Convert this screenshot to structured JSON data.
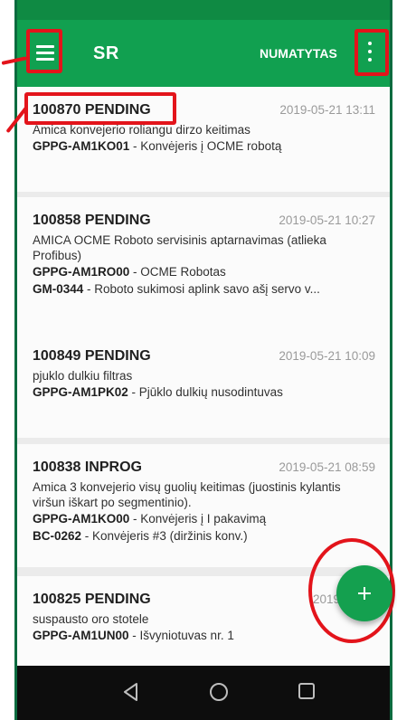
{
  "app": {
    "title": "SR",
    "action_label": "NUMATYTAS",
    "menu_icon": "menu-icon",
    "overflow_icon": "more-vert-icon"
  },
  "requests": [
    {
      "id_status": "100870 PENDING",
      "date": "2019-05-21 13:11",
      "description": "Amica konvejerio roliangu dirzo keitimas",
      "lines": [
        {
          "code": "GPPG-AM1KO01",
          "text": " - Konvėjeris į OCME robotą"
        }
      ]
    },
    {
      "id_status": "100858 PENDING",
      "date": "2019-05-21 10:27",
      "description": "AMICA OCME Roboto servisinis aptarnavimas (atlieka Profibus)",
      "lines": [
        {
          "code": "GPPG-AM1RO00",
          "text": " - OCME Robotas"
        },
        {
          "code": "GM-0344",
          "text": " - Roboto sukimosi aplink savo ašį servo v..."
        }
      ]
    },
    {
      "id_status": "100849 PENDING",
      "date": "2019-05-21 10:09",
      "description": "pjuklo dulkiu filtras",
      "lines": [
        {
          "code": "GPPG-AM1PK02",
          "text": " - Pjūklo dulkių nusodintuvas"
        }
      ]
    },
    {
      "id_status": "100838 INPROG",
      "date": "2019-05-21 08:59",
      "description": "Amica 3 konvejerio visų guolių keitimas (juostinis kylantis viršun iškart po segmentinio).",
      "lines": [
        {
          "code": "GPPG-AM1KO00",
          "text": " - Konvėjeris į I pakavimą"
        },
        {
          "code": "BC-0262",
          "text": " - Konvėjeris #3 (diržinis konv.)"
        }
      ]
    },
    {
      "id_status": "100825 PENDING",
      "date": "2019-05-21",
      "description": "suspausto oro stotele",
      "lines": [
        {
          "code": "GPPG-AM1UN00",
          "text": " - Išvyniotuvas nr. 1"
        }
      ]
    }
  ],
  "fab": {
    "icon": "plus-icon"
  },
  "nav": {
    "back_icon": "back-icon",
    "home_icon": "home-icon",
    "recents_icon": "recents-icon"
  },
  "colors": {
    "primary": "#11a050",
    "annotation": "#e3141b",
    "background": "#ebebeb"
  }
}
